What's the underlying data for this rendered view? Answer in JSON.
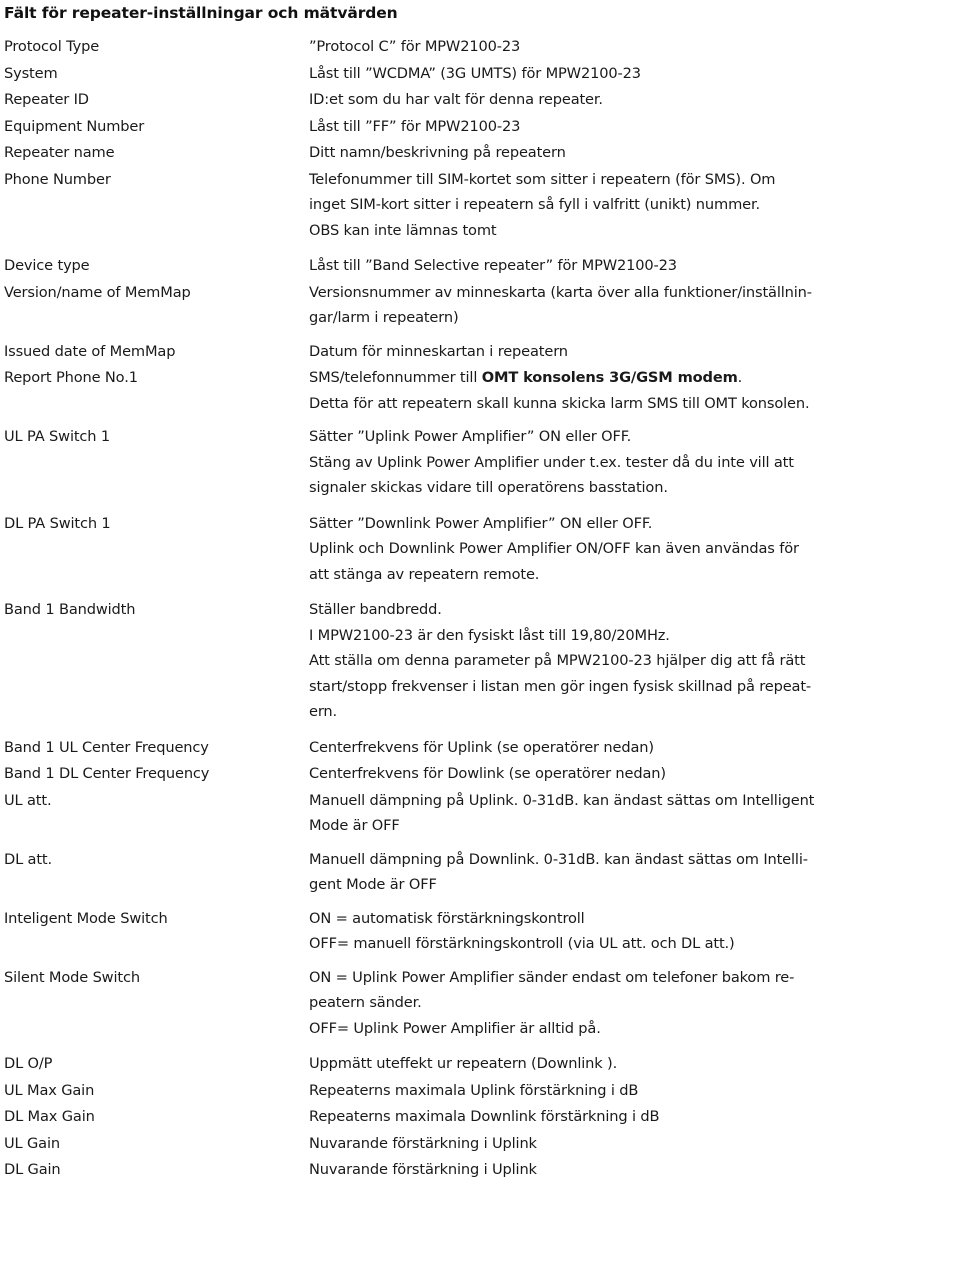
{
  "document": {
    "title": "Fält för repeater-inställningar och mätvärden"
  },
  "rows": [
    {
      "label": "Protocol Type",
      "lines": [
        {
          "text": "”Protocol C” för MPW2100-23"
        }
      ]
    },
    {
      "label": "System",
      "lines": [
        {
          "text": "Låst till ”WCDMA” (3G UMTS) för MPW2100-23"
        }
      ]
    },
    {
      "label": "Repeater ID",
      "lines": [
        {
          "text": "ID:et som du har valt för denna repeater."
        }
      ]
    },
    {
      "label": "Equipment Number",
      "lines": [
        {
          "text": "Låst till ”FF” för MPW2100-23"
        }
      ]
    },
    {
      "label": "Repeater name",
      "lines": [
        {
          "text": "Ditt namn/beskrivning på repeatern"
        }
      ]
    },
    {
      "label": "Phone Number",
      "lines": [
        {
          "text": "Telefonummer till SIM-kortet som sitter i repeatern (för SMS). Om"
        },
        {
          "text": "inget SIM-kort sitter i repeatern så fyll i valfritt (unikt) nummer."
        },
        {
          "text": "OBS kan inte lämnas tomt"
        }
      ]
    },
    {
      "label": "Device type",
      "lines": [
        {
          "text": "Låst till ”Band Selective repeater” för MPW2100-23"
        }
      ]
    },
    {
      "label": "Version/name of MemMap",
      "lines": [
        {
          "text": "Versionsnummer av  minneskarta (karta över alla funktioner/inställnin-"
        },
        {
          "text": "gar/larm i repeatern)"
        }
      ]
    },
    {
      "label": "Issued date of MemMap",
      "lines": [
        {
          "text": "Datum för minneskartan i repeatern"
        }
      ]
    },
    {
      "label": "Report Phone No.1",
      "lines": [
        {
          "pre": "SMS/telefonnummer till ",
          "bold": "OMT konsolens 3G/GSM modem",
          "post": "."
        },
        {
          "text": "Detta för att repeatern skall kunna skicka larm SMS till OMT konsolen."
        }
      ]
    },
    {
      "label": "UL PA Switch 1",
      "lines": [
        {
          "text": "Sätter ”Uplink Power Amplifier” ON eller OFF."
        },
        {
          "text": "Stäng av Uplink Power Amplifier under t.ex. tester då du inte vill att"
        },
        {
          "text": "signaler skickas vidare till operatörens basstation."
        }
      ]
    },
    {
      "label": "DL PA Switch 1",
      "lines": [
        {
          "text": "Sätter ”Downlink Power Amplifier”  ON eller OFF."
        },
        {
          "text": "Uplink och Downlink Power Amplifier ON/OFF kan även användas för"
        },
        {
          "text": "att stänga av repeatern remote."
        }
      ]
    },
    {
      "label": "Band 1 Bandwidth",
      "lines": [
        {
          "text": "Ställer bandbredd."
        },
        {
          "text": "I MPW2100-23 är den fysiskt låst till 19,80/20MHz."
        },
        {
          "text": "Att ställa om denna parameter på MPW2100-23 hjälper dig att få rätt"
        },
        {
          "text": "start/stopp frekvenser i listan men gör ingen fysisk skillnad på repeat-"
        },
        {
          "text": "ern."
        }
      ]
    },
    {
      "label": "Band 1 UL Center Frequency",
      "lines": [
        {
          "text": "Centerfrekvens för Uplink (se operatörer nedan)"
        }
      ]
    },
    {
      "label": "Band 1 DL Center Frequency",
      "lines": [
        {
          "text": "Centerfrekvens för Dowlink (se operatörer nedan)"
        }
      ]
    },
    {
      "label": "UL att.",
      "lines": [
        {
          "text": "Manuell dämpning på Uplink. 0-31dB. kan ändast sättas om Intelligent"
        },
        {
          "text": "Mode är OFF"
        }
      ]
    },
    {
      "label": "DL att.",
      "lines": [
        {
          "text": "Manuell dämpning på Downlink. 0-31dB. kan ändast sättas om Intelli-"
        },
        {
          "text": "gent Mode är OFF"
        }
      ]
    },
    {
      "label": "Inteligent Mode Switch",
      "lines": [
        {
          "text": "ON = automatisk förstärkningskontroll"
        },
        {
          "text": "OFF= manuell förstärkningskontroll (via UL att. och DL att.)"
        }
      ]
    },
    {
      "label": "Silent Mode Switch",
      "lines": [
        {
          "text": "ON =  Uplink Power Amplifier sänder endast om telefoner bakom re-"
        },
        {
          "text": "peatern sänder."
        },
        {
          "text": "OFF= Uplink Power Amplifier är alltid på."
        }
      ]
    },
    {
      "label": "DL O/P",
      "lines": [
        {
          "text": "Uppmätt uteffekt ur repeatern (Downlink )."
        }
      ]
    },
    {
      "label": "UL Max Gain",
      "lines": [
        {
          "text": "Repeaterns maximala Uplink förstärkning i dB"
        }
      ]
    },
    {
      "label": "DL Max Gain",
      "lines": [
        {
          "text": "Repeaterns maximala Downlink förstärkning i dB"
        }
      ]
    },
    {
      "label": "UL Gain",
      "lines": [
        {
          "text": "Nuvarande förstärkning i Uplink"
        }
      ]
    },
    {
      "label": "DL Gain",
      "lines": [
        {
          "text": "Nuvarande förstärkning i Uplink"
        }
      ]
    }
  ]
}
